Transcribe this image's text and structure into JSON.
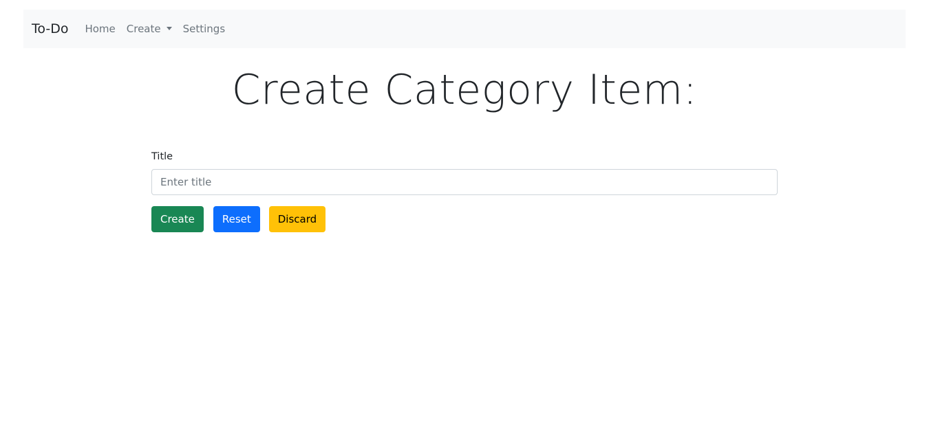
{
  "navbar": {
    "brand": "To-Do",
    "items": [
      {
        "label": "Home"
      },
      {
        "label": "Create",
        "has_dropdown": true
      },
      {
        "label": "Settings"
      }
    ]
  },
  "page": {
    "title": "Create Category Item:"
  },
  "form": {
    "title_label": "Title",
    "title_value": "",
    "title_placeholder": "Enter title",
    "buttons": {
      "create": "Create",
      "reset": "Reset",
      "discard": "Discard"
    }
  },
  "colors": {
    "navbar_bg": "#f8f9fa",
    "create_button": "#198754",
    "reset_button": "#0d6efd",
    "discard_button": "#ffc107"
  }
}
